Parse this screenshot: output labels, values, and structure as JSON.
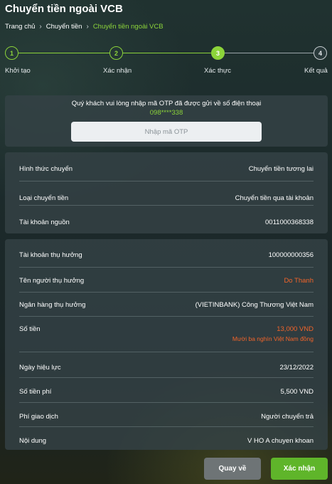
{
  "page": {
    "title": "Chuyển tiền ngoài VCB"
  },
  "breadcrumb": [
    {
      "label": "Trang chủ"
    },
    {
      "label": "Chuyển tiền"
    },
    {
      "label": "Chuyển tiền ngoài VCB"
    }
  ],
  "stepper": {
    "current_step": 3,
    "steps": [
      {
        "num": "1",
        "label": "Khởi tạo",
        "state": "done"
      },
      {
        "num": "2",
        "label": "Xác nhận",
        "state": "done"
      },
      {
        "num": "3",
        "label": "Xác thực",
        "state": "current"
      },
      {
        "num": "4",
        "label": "Kết quả",
        "state": "todo"
      }
    ]
  },
  "otp": {
    "message": "Quý khách vui lòng nhập mã OTP đã được gửi về số điện thoại",
    "phone": "098****338",
    "input_placeholder": "Nhập mã OTP",
    "input_value": ""
  },
  "transfer_info": [
    {
      "label": "Hình thức chuyển",
      "value": "Chuyển tiền tương lai"
    },
    {
      "label": "Loại chuyển tiền",
      "value": "Chuyển tiền qua tài khoản"
    },
    {
      "label": "Tài khoản nguồn",
      "value": "0011000368338"
    }
  ],
  "beneficiary_info": {
    "account_label": "Tài khoản thụ hưởng",
    "account_value": "100000000356",
    "name_label": "Tên người thụ hưởng",
    "name_value": "Do Thanh",
    "bank_label": "Ngân hàng thụ hưởng",
    "bank_value": "(VIETINBANK) Công Thương Việt Nam",
    "amount_label": "Số tiền",
    "amount_value": "13,000 VND",
    "amount_words": "Mười ba nghìn Việt Nam đồng",
    "date_label": "Ngày hiệu lực",
    "date_value": "23/12/2022",
    "fee_label": "Số tiền phí",
    "fee_value": "5,500 VND",
    "fee_payer_label": "Phí giao dịch",
    "fee_payer_value": "Người chuyển trả",
    "content_label": "Nội dung",
    "content_value": "V HO A chuyen khoan"
  },
  "buttons": {
    "back": "Quay về",
    "confirm": "Xác nhận"
  },
  "colors": {
    "accent": "#8cd43a",
    "highlight": "#f2642a",
    "back_button": "#6e7476",
    "confirm_button": "#5fb52a"
  }
}
